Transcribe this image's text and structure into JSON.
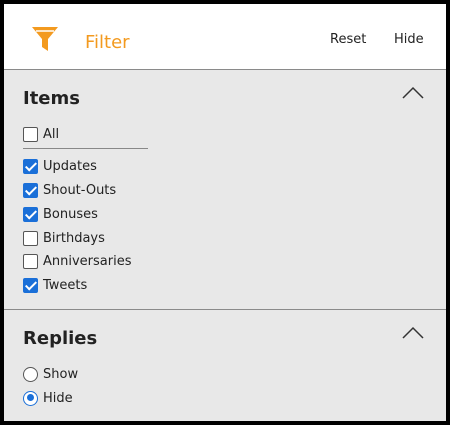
{
  "header": {
    "title": "Filter",
    "icon": "filter-funnel-icon",
    "reset_label": "Reset",
    "hide_label": "Hide",
    "accent_color": "#f39a1f"
  },
  "items": {
    "title": "Items",
    "collapse_icon": "chevron-up-icon",
    "all": {
      "label": "All",
      "checked": false
    },
    "options": [
      {
        "label": "Updates",
        "checked": true
      },
      {
        "label": "Shout-Outs",
        "checked": true
      },
      {
        "label": "Bonuses",
        "checked": true
      },
      {
        "label": "Birthdays",
        "checked": false
      },
      {
        "label": "Anniversaries",
        "checked": false
      },
      {
        "label": "Tweets",
        "checked": true
      }
    ]
  },
  "replies": {
    "title": "Replies",
    "collapse_icon": "chevron-up-icon",
    "options": [
      {
        "label": "Show",
        "selected": false
      },
      {
        "label": "Hide",
        "selected": true
      }
    ]
  },
  "check_color": "#1a6fd8"
}
